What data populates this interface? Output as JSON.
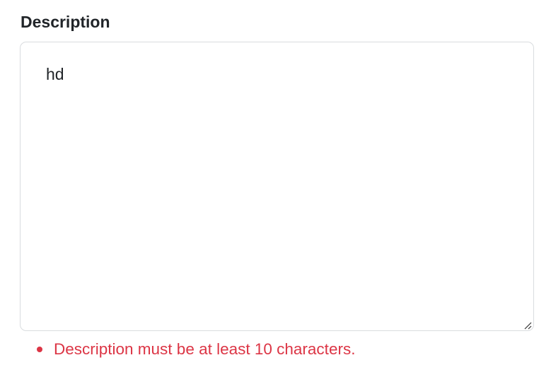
{
  "description_field": {
    "label": "Description",
    "value": "hd",
    "border_color": "#d9dcdf",
    "resize_icon": "resize-grip-icon"
  },
  "validation": {
    "errors": [
      "Description must be at least 10 characters."
    ],
    "error_color": "#dc3545"
  }
}
